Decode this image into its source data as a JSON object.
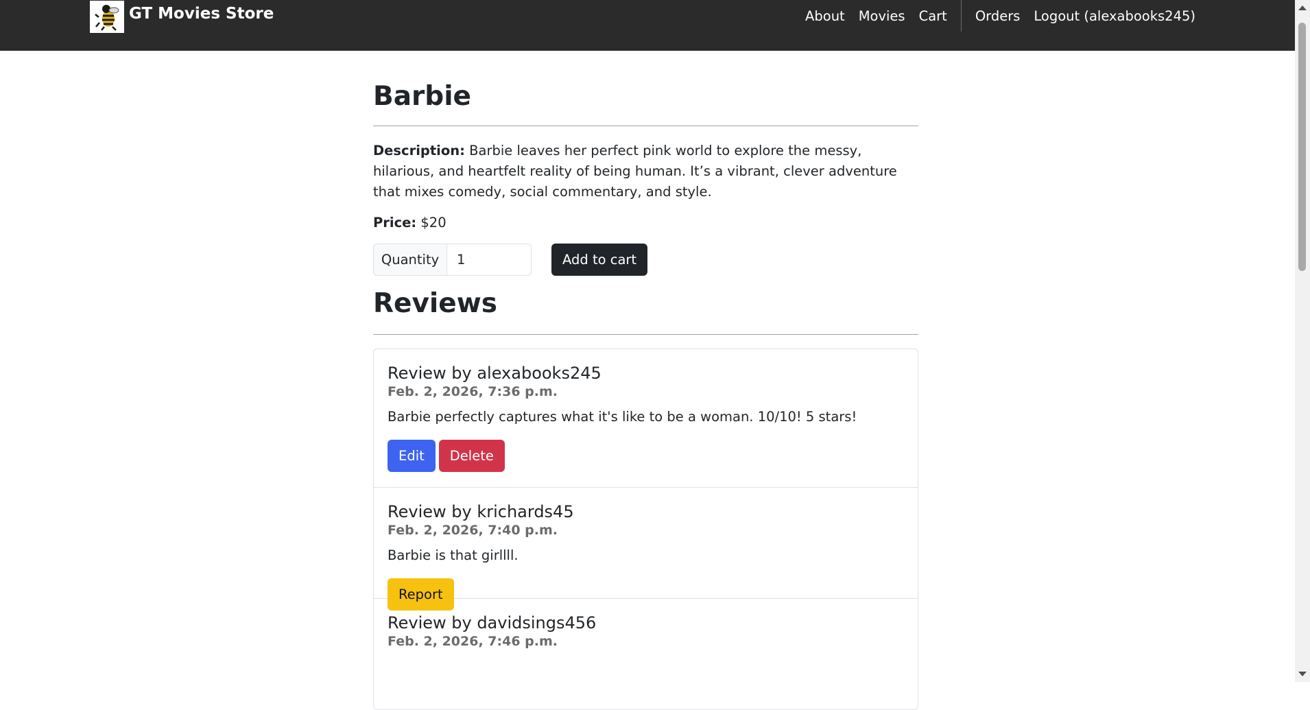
{
  "nav": {
    "brand": "GT Movies Store",
    "links": [
      "About",
      "Movies",
      "Cart"
    ],
    "user_links": [
      "Orders",
      "Logout (alexabooks245)"
    ]
  },
  "movie": {
    "title": "Barbie",
    "description_label": "Description:",
    "description": "Barbie leaves her perfect pink world to explore the messy, hilarious, and heartfelt reality of being human. It’s a vibrant, clever adventure that mixes comedy, social commentary, and style.",
    "price_label": "Price:",
    "price": "$20",
    "quantity_label": "Quantity",
    "quantity_value": "1",
    "add_to_cart": "Add to cart"
  },
  "reviews": {
    "heading": "Reviews",
    "items": [
      {
        "title": "Review by alexabooks245",
        "date": "Feb. 2, 2026, 7:36 p.m.",
        "text": "Barbie perfectly captures what it's like to be a woman. 10/10! 5 stars!",
        "edit": "Edit",
        "delete": "Delete"
      },
      {
        "title": "Review by krichards45",
        "date": "Feb. 2, 2026, 7:40 p.m.",
        "text": "Barbie is that girllll.",
        "report": "Report"
      },
      {
        "title": "Review by davidsings456",
        "date": "Feb. 2, 2026, 7:46 p.m."
      }
    ]
  },
  "colors": {
    "navbar": "#2b2b2b",
    "primary": "#3d63f0",
    "danger": "#d1344a",
    "warning": "#f6c20f",
    "dark": "#212529"
  }
}
